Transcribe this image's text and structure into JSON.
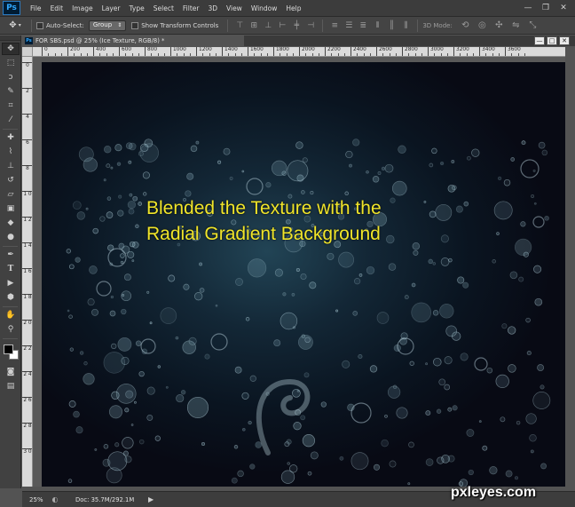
{
  "app": {
    "logo": "Ps"
  },
  "menu": {
    "items": [
      "File",
      "Edit",
      "Image",
      "Layer",
      "Type",
      "Select",
      "Filter",
      "3D",
      "View",
      "Window",
      "Help"
    ]
  },
  "window_controls": {
    "minimize": "—",
    "restore": "❐",
    "close": "✕"
  },
  "options": {
    "auto_select_label": "Auto-Select:",
    "auto_select_value": "Group",
    "transform_label": "Show Transform Controls",
    "mode3d_label": "3D Mode:"
  },
  "document": {
    "tab_title": "FOR SBS.psd @ 25% (Ice Texture, RGB/8) *",
    "tab_close": "×",
    "win_minimize": "—",
    "win_restore": "□",
    "win_close": "✕"
  },
  "ruler": {
    "h_labels": [
      "0",
      "200",
      "400",
      "600",
      "800",
      "1000",
      "1200",
      "1400",
      "1600",
      "1800",
      "2000",
      "2200",
      "2400",
      "2600",
      "2800",
      "3000",
      "3200",
      "3400",
      "3600"
    ],
    "v_labels": [
      "0",
      "2",
      "4",
      "6",
      "8",
      "1 0",
      "1 2",
      "1 4",
      "1 6",
      "1 8",
      "2 0",
      "2 2",
      "2 4",
      "2 6",
      "2 8",
      "3 0"
    ]
  },
  "canvas": {
    "caption_line1": "Blended the Texture with the",
    "caption_line2": "Radial Gradient Background",
    "caption_color": "#f0e52a"
  },
  "status": {
    "zoom": "25%",
    "doc_size": "Doc: 35.7M/292.1M",
    "arrow": "▶"
  },
  "watermark": "pxleyes.com",
  "colors": {
    "foreground_swatch": "#000000",
    "background_swatch": "#ffffff",
    "accent": "#31a8ff"
  }
}
